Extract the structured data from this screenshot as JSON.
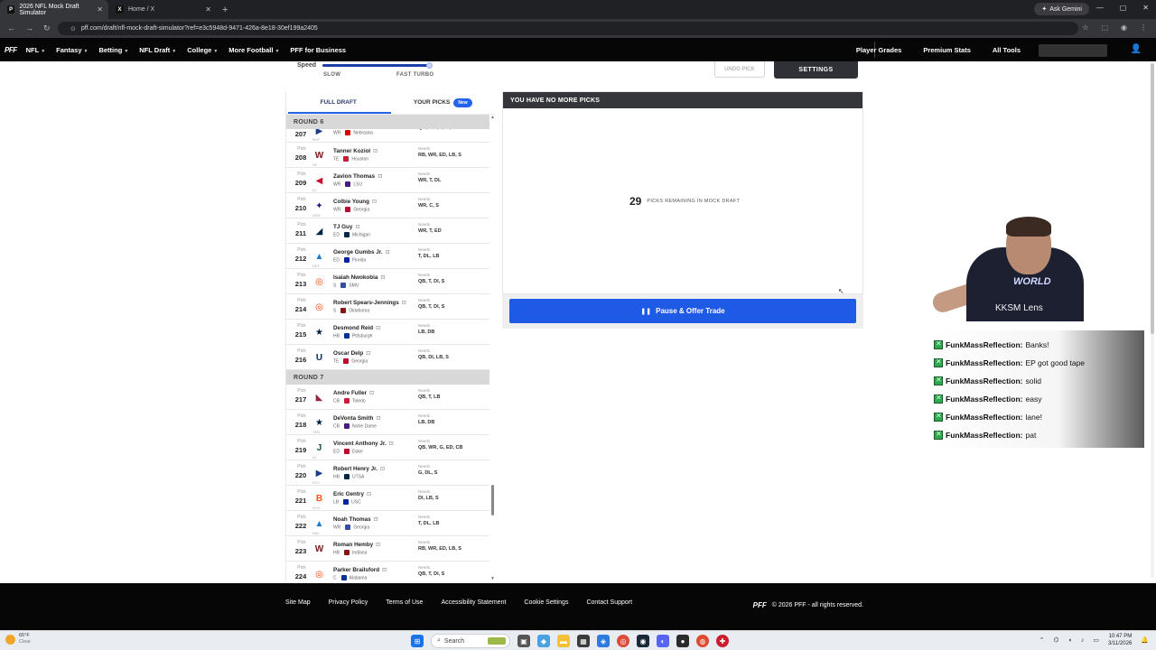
{
  "browser": {
    "tabs": [
      {
        "title": "2026 NFL Mock Draft Simulator",
        "active": true
      },
      {
        "title": "Home / X",
        "active": false
      }
    ],
    "ask_gemini": "Ask Gemini",
    "url": "pff.com/draft/nfl-mock-draft-simulator?ref=e3c5948d-9471-426a-8e18-30ef199a2405"
  },
  "nav": {
    "logo": "PFF",
    "items": [
      "NFL",
      "Fantasy",
      "Betting",
      "NFL Draft",
      "College",
      "More Football",
      "PFF for Business"
    ],
    "dropdown_items": [
      true,
      true,
      true,
      true,
      true,
      true,
      false
    ],
    "right_items": [
      "Player Grades",
      "Premium Stats",
      "All Tools"
    ]
  },
  "controls": {
    "speed_label": "Speed",
    "slow": "SLOW",
    "fast": "FAST TURBO",
    "speed_value": 1.0,
    "undo": "UNDO PICK",
    "settings": "SETTINGS"
  },
  "panel": {
    "tab_full": "FULL DRAFT",
    "tab_yours": "YOUR PICKS",
    "tab_new": "New",
    "pick_label": "Pick",
    "needs_label": "Needs",
    "rounds": [
      {
        "title": "ROUND 6",
        "picks": [
          {
            "num": "207",
            "team": "BUF",
            "logo": "buf",
            "name": "",
            "pos": "WR",
            "school": "Nebraska",
            "needs": "QB, WR, T, DI, CB",
            "partial": true
          },
          {
            "num": "208",
            "team": "SF",
            "logo": "was",
            "name": "Tanner Koziol",
            "pos": "TE",
            "school": "Houston",
            "needs": "RB, WR, ED, LB, S"
          },
          {
            "num": "209",
            "team": "LV",
            "logo": "kc",
            "name": "Zavion Thomas",
            "pos": "WR",
            "school": "LSU",
            "needs": "WR, T, DL"
          },
          {
            "num": "210",
            "team": "DEN",
            "logo": "bal",
            "name": "Colbie Young",
            "pos": "WR",
            "school": "Georgia",
            "needs": "WR, C, S"
          },
          {
            "num": "211",
            "team": "",
            "logo": "ne",
            "name": "TJ Guy",
            "pos": "ED",
            "school": "Michigan",
            "needs": "WR, T, ED"
          },
          {
            "num": "212",
            "team": "DET",
            "logo": "det",
            "name": "George Gumbs Jr.",
            "pos": "ED",
            "school": "Florida",
            "needs": "T, DL, LB"
          },
          {
            "num": "213",
            "team": "",
            "logo": "cle",
            "name": "Isaiah Nwokobia",
            "pos": "S",
            "school": "SMU",
            "needs": "QB, T, DI, S"
          },
          {
            "num": "214",
            "team": "",
            "logo": "cle",
            "name": "Robert Spears-Jennings",
            "pos": "S",
            "school": "Oklahoma",
            "needs": "QB, T, DI, S"
          },
          {
            "num": "215",
            "team": "",
            "logo": "dal",
            "name": "Desmond Reid",
            "pos": "HB",
            "school": "Pittsburgh",
            "needs": "LB, DB"
          },
          {
            "num": "216",
            "team": "",
            "logo": "ind",
            "name": "Oscar Delp",
            "pos": "TE",
            "school": "Georgia",
            "needs": "QB, DI, LB, S"
          }
        ]
      },
      {
        "title": "ROUND 7",
        "picks": [
          {
            "num": "217",
            "team": "",
            "logo": "ari",
            "name": "Andre Fuller",
            "pos": "CB",
            "school": "Toledo",
            "needs": "QB, T, LB"
          },
          {
            "num": "218",
            "team": "TEN",
            "logo": "dal",
            "name": "DeVonta Smith",
            "pos": "CB",
            "school": "Notre Dame",
            "needs": "LB, DB"
          },
          {
            "num": "219",
            "team": "LV",
            "logo": "nyj",
            "name": "Vincent Anthony Jr.",
            "pos": "ED",
            "school": "Duke",
            "needs": "QB, WR, G, ED, CB"
          },
          {
            "num": "220",
            "team": "NYJ",
            "logo": "buf",
            "name": "Robert Henry Jr.",
            "pos": "HB",
            "school": "UTSA",
            "needs": "G, DL, S"
          },
          {
            "num": "221",
            "team": "NYG",
            "logo": "cin",
            "name": "Eric Gentry",
            "pos": "LB",
            "school": "USC",
            "needs": "DI, LB, S"
          },
          {
            "num": "222",
            "team": "DAL",
            "logo": "det",
            "name": "Noah Thomas",
            "pos": "WR",
            "school": "Georgia",
            "needs": "T, DL, LB"
          },
          {
            "num": "223",
            "team": "",
            "logo": "was",
            "name": "Roman Hemby",
            "pos": "HB",
            "school": "Indiana",
            "needs": "RB, WR, ED, LB, S"
          },
          {
            "num": "224",
            "team": "",
            "logo": "cle",
            "name": "Parker Brailsford",
            "pos": "C",
            "school": "Alabama",
            "needs": "QB, T, DI, S",
            "partial": true
          }
        ]
      }
    ]
  },
  "picks_box": {
    "header": "YOU HAVE NO MORE PICKS",
    "remaining": "29",
    "remaining_text": "PICKS REMAINING IN MOCK DRAFT",
    "button": "Pause & Offer Trade"
  },
  "stream": {
    "lens": "KKSM Lens",
    "shirt": "WORLD",
    "chat": [
      {
        "user": "FunkMassReflection:",
        "msg": "Banks!"
      },
      {
        "user": "FunkMassReflection:",
        "msg": "EP got good tape"
      },
      {
        "user": "FunkMassReflection:",
        "msg": "solid"
      },
      {
        "user": "FunkMassReflection:",
        "msg": "easy"
      },
      {
        "user": "FunkMassReflection:",
        "msg": "lane!"
      },
      {
        "user": "FunkMassReflection:",
        "msg": "pat"
      }
    ]
  },
  "footer": {
    "links": [
      "Site Map",
      "Privacy Policy",
      "Terms of Use",
      "Accessibility Statement",
      "Cookie Settings",
      "Contact Support"
    ],
    "logo": "PFF",
    "copyright": "© 2026 PFF - all rights reserved."
  },
  "taskbar": {
    "temp": "65°F",
    "condition": "Clear",
    "search": "Search",
    "time": "10:47 PM",
    "date": "3/11/2026"
  },
  "colors": {
    "accent": "#1f5ae6",
    "header_dark": "#34363b",
    "round_bg": "#d8d8d8"
  }
}
